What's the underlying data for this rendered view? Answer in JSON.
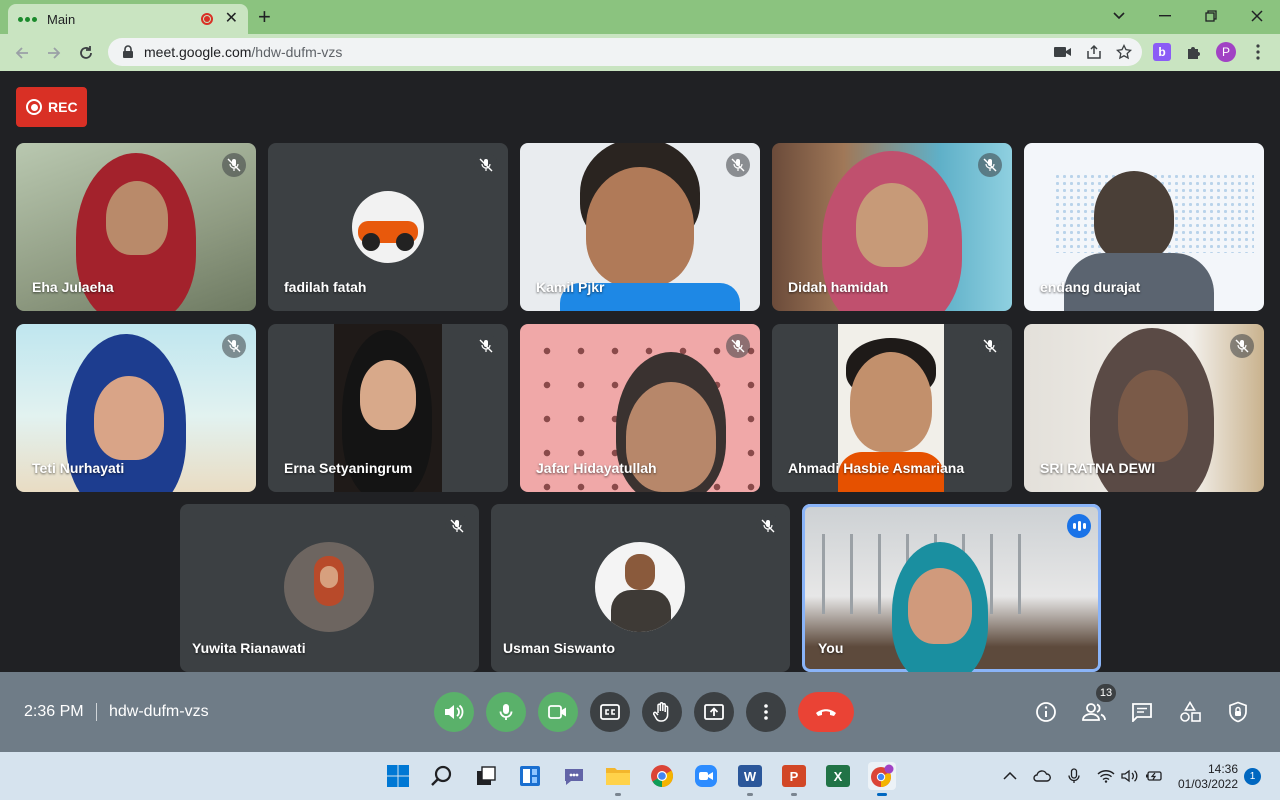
{
  "browser": {
    "tab_title": "Main",
    "tab_close": "✕",
    "new_tab": "+",
    "window_controls": [
      "chevron-down-icon",
      "minimize-icon",
      "restore-icon",
      "close-icon"
    ],
    "url_host": "meet.google.com",
    "url_path": "/hdw-dufm-vzs",
    "profile_initial": "P",
    "extension_letter": "b"
  },
  "meeting": {
    "rec_label": "REC",
    "time": "2:36 PM",
    "code": "hdw-dufm-vzs",
    "participant_count": "13",
    "colors": {
      "record": "#d93025",
      "green_control": "#5ab16a",
      "end_call": "#ea4335",
      "speaking": "#8ab4f8"
    }
  },
  "participants": [
    {
      "name": "Eha Julaeha",
      "muted": true
    },
    {
      "name": "fadilah fatah",
      "muted": true
    },
    {
      "name": "Kamil Pjkr",
      "muted": true
    },
    {
      "name": "Didah hamidah",
      "muted": true
    },
    {
      "name": "endang durajat",
      "muted": false
    },
    {
      "name": "Teti Nurhayati",
      "muted": true
    },
    {
      "name": "Erna Setyaningrum",
      "muted": true
    },
    {
      "name": "Jafar Hidayatullah",
      "muted": true
    },
    {
      "name": "Ahmadi Hasbie Asmariana",
      "muted": true
    },
    {
      "name": "SRI RATNA DEWI",
      "muted": true
    },
    {
      "name": "Yuwita Rianawati",
      "muted": true
    },
    {
      "name": "Usman Siswanto",
      "muted": true
    },
    {
      "name": "You",
      "muted": false,
      "speaking": true
    }
  ],
  "taskbar": {
    "time": "14:36",
    "date": "01/03/2022",
    "notification_count": "1",
    "office_letters": {
      "word": "W",
      "powerpoint": "P",
      "excel": "X"
    }
  }
}
